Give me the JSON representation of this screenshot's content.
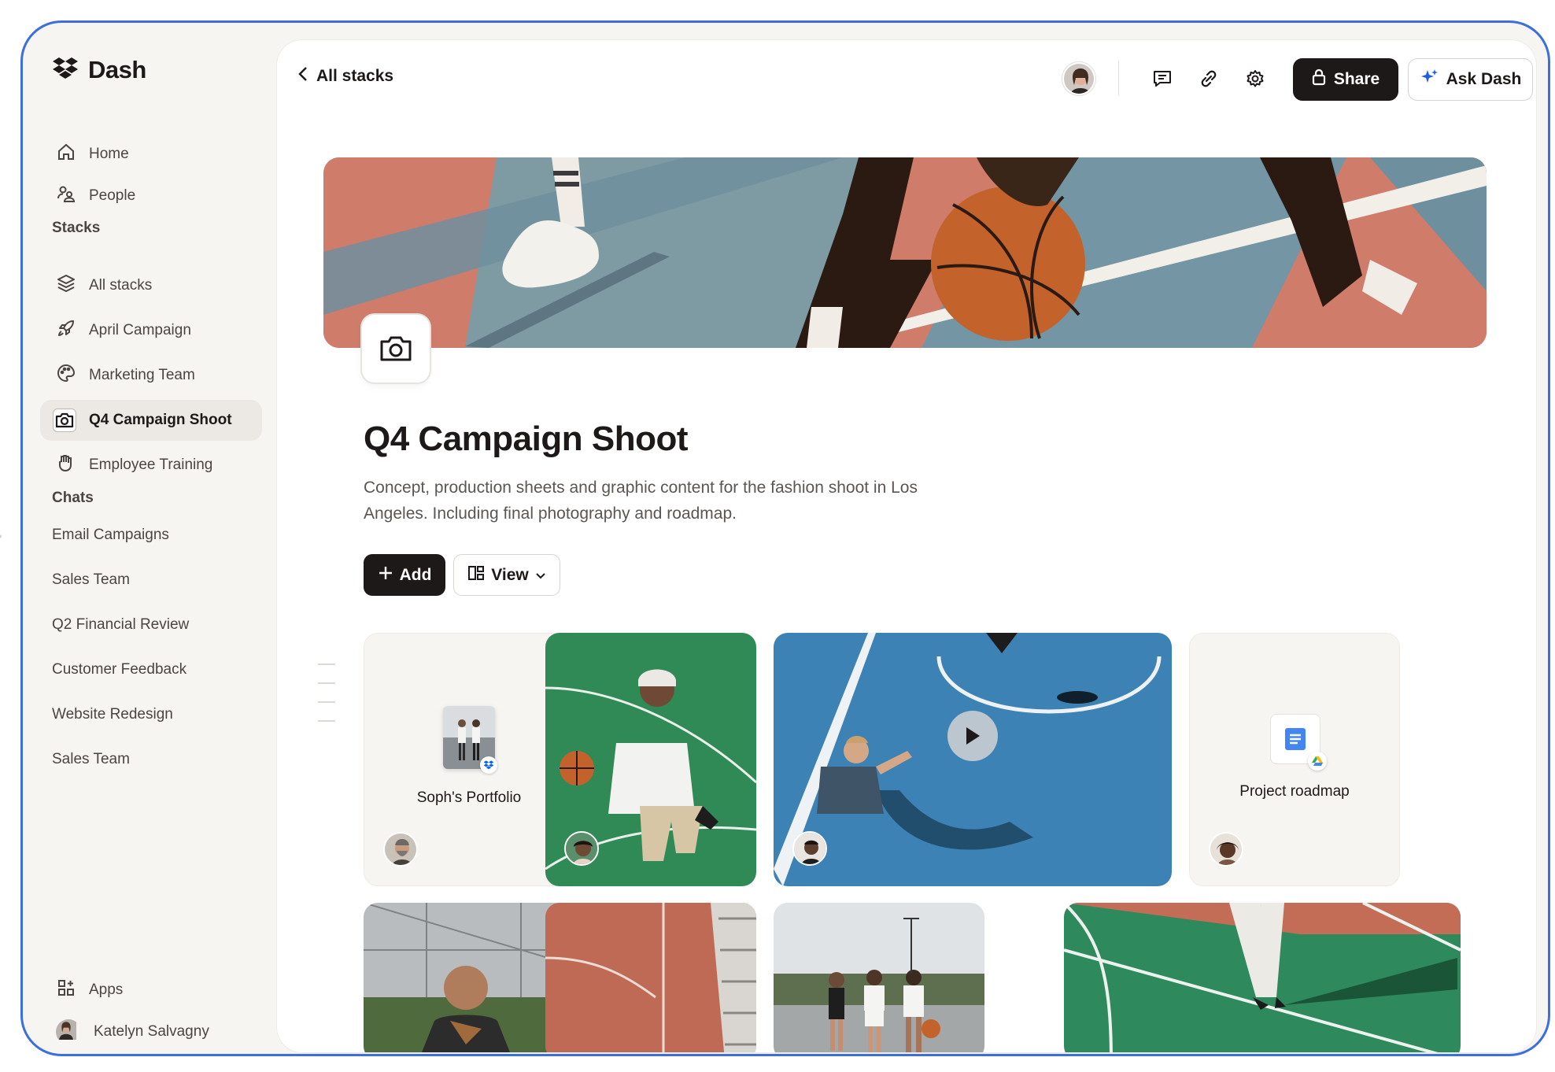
{
  "app": {
    "name": "Dash"
  },
  "sidebar": {
    "nav": [
      {
        "label": "Home",
        "icon": "home-icon"
      },
      {
        "label": "People",
        "icon": "people-icon"
      }
    ],
    "stacks_title": "Stacks",
    "stacks": [
      {
        "label": "All stacks",
        "icon": "stack-icon"
      },
      {
        "label": "April Campaign",
        "icon": "rocket-icon"
      },
      {
        "label": "Marketing Team",
        "icon": "palette-icon"
      },
      {
        "label": "Q4 Campaign Shoot",
        "icon": "camera-icon",
        "active": true
      },
      {
        "label": "Employee Training",
        "icon": "hand-icon"
      }
    ],
    "chats_title": "Chats",
    "chats": [
      "Email Campaigns",
      "Sales Team",
      "Q2 Financial Review",
      "Customer Feedback",
      "Website Redesign",
      "Sales Team"
    ],
    "apps_label": "Apps",
    "user_name": "Katelyn Salvagny"
  },
  "header": {
    "back_label": "All stacks",
    "share_label": "Share",
    "ask_label": "Ask Dash",
    "icons": [
      "comment-icon",
      "link-icon",
      "settings-icon"
    ]
  },
  "stack": {
    "title": "Q4 Campaign Shoot",
    "description": "Concept, production sheets and graphic content for the fashion shoot in Los Angeles. Including final photography and roadmap.",
    "add_label": "Add",
    "view_label": "View"
  },
  "cards": [
    {
      "type": "file",
      "label": "Soph's Portfolio",
      "source": "dropbox"
    },
    {
      "type": "image",
      "subject": "man sitting on green court with basketball"
    },
    {
      "type": "video",
      "subject": "child on blue basketball court"
    },
    {
      "type": "file",
      "label": "Project roadmap",
      "source": "google-drive"
    },
    {
      "type": "image",
      "subject": "portrait with fence"
    },
    {
      "type": "image",
      "subject": "red court with bleachers"
    },
    {
      "type": "image",
      "subject": "three people on court"
    },
    {
      "type": "image",
      "subject": "green court with player"
    }
  ],
  "colors": {
    "accent": "#3b6fe0",
    "dark": "#1e1919",
    "sidebar_bg": "#f7f5f2"
  }
}
